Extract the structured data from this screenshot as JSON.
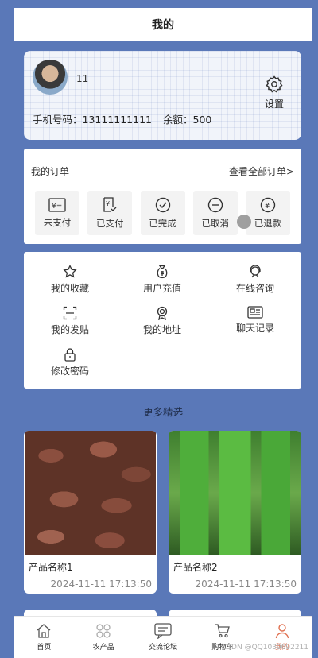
{
  "header": {
    "title": "我的"
  },
  "profile": {
    "username": "11",
    "settings_label": "设置",
    "phone_label": "手机号码：",
    "phone": "13111111111",
    "balance_label": "余额：",
    "balance": "500"
  },
  "orders": {
    "title": "我的订单",
    "view_all": "查看全部订单>",
    "items": [
      {
        "label": "未支付",
        "icon": "unpaid-icon"
      },
      {
        "label": "已支付",
        "icon": "paid-icon"
      },
      {
        "label": "已完成",
        "icon": "check-circle-icon"
      },
      {
        "label": "已取消",
        "icon": "minus-circle-icon"
      },
      {
        "label": "已退款",
        "icon": "refund-icon"
      }
    ]
  },
  "menu": {
    "items": [
      {
        "label": "我的收藏",
        "icon": "star-icon"
      },
      {
        "label": "用户充值",
        "icon": "money-bag-icon"
      },
      {
        "label": "在线咨询",
        "icon": "support-icon"
      },
      {
        "label": "我的发贴",
        "icon": "scan-icon"
      },
      {
        "label": "我的地址",
        "icon": "badge-icon"
      },
      {
        "label": "聊天记录",
        "icon": "id-card-icon"
      },
      {
        "label": "修改密码",
        "icon": "lock-icon"
      }
    ]
  },
  "more": {
    "title": "更多精选"
  },
  "products": [
    {
      "name": "产品名称1",
      "date": "2024-11-11 17:13:50",
      "image": "sweet-potatoes"
    },
    {
      "name": "产品名称2",
      "date": "2024-11-11 17:13:50",
      "image": "bitter-melons"
    }
  ],
  "tabbar": {
    "items": [
      {
        "label": "首页",
        "icon": "home-icon"
      },
      {
        "label": "农产品",
        "icon": "grid-icon"
      },
      {
        "label": "交流论坛",
        "icon": "chat-icon"
      },
      {
        "label": "购物车",
        "icon": "cart-icon"
      },
      {
        "label": "我的",
        "icon": "user-icon",
        "active": true
      }
    ]
  },
  "watermark": "CSDN @QQ1039692211",
  "colors": {
    "background": "#5a78b8",
    "active_tab": "#e07050"
  }
}
